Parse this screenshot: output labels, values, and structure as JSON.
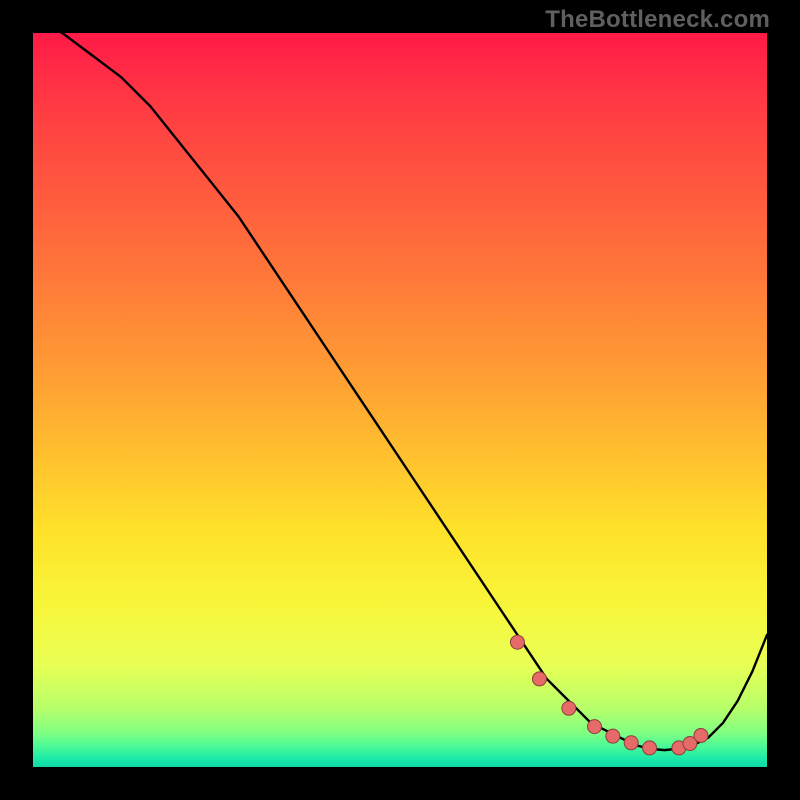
{
  "watermark": "TheBottleneck.com",
  "colors": {
    "bg_black": "#000000",
    "curve": "#000000",
    "dot_fill": "#e66a67",
    "dot_stroke": "#8c3f3d"
  },
  "gradient_stops": [
    {
      "offset": 0.0,
      "color": "#ff1a47"
    },
    {
      "offset": 0.1,
      "color": "#ff3b43"
    },
    {
      "offset": 0.22,
      "color": "#ff5a3e"
    },
    {
      "offset": 0.35,
      "color": "#ff7d39"
    },
    {
      "offset": 0.48,
      "color": "#ffa233"
    },
    {
      "offset": 0.58,
      "color": "#ffc22e"
    },
    {
      "offset": 0.68,
      "color": "#ffe22a"
    },
    {
      "offset": 0.78,
      "color": "#f8f63a"
    },
    {
      "offset": 0.86,
      "color": "#e9ff55"
    },
    {
      "offset": 0.92,
      "color": "#b7ff6a"
    },
    {
      "offset": 0.955,
      "color": "#7dff83"
    },
    {
      "offset": 0.975,
      "color": "#41f79a"
    },
    {
      "offset": 0.99,
      "color": "#18e9a8"
    },
    {
      "offset": 1.0,
      "color": "#0fd8a4"
    }
  ],
  "chart_data": {
    "type": "line",
    "title": "",
    "xlabel": "",
    "ylabel": "",
    "xlim": [
      0,
      100
    ],
    "ylim": [
      0,
      100
    ],
    "series": [
      {
        "name": "bottleneck-curve",
        "x": [
          0,
          4,
          8,
          12,
          16,
          20,
          24,
          28,
          32,
          36,
          40,
          44,
          48,
          52,
          56,
          60,
          64,
          68,
          70,
          72,
          74,
          76,
          78,
          80,
          82,
          84,
          86,
          88,
          90,
          92,
          94,
          96,
          98,
          100
        ],
        "y": [
          102,
          100,
          97,
          94,
          90,
          85,
          80,
          75,
          69,
          63,
          57,
          51,
          45,
          39,
          33,
          27,
          21,
          15,
          12,
          10,
          8,
          6,
          5,
          4,
          3,
          2.5,
          2.3,
          2.5,
          3,
          4,
          6,
          9,
          13,
          18
        ]
      }
    ],
    "highlight_points": {
      "name": "optimal-zone-dots",
      "x": [
        66,
        69,
        73,
        76.5,
        79,
        81.5,
        84,
        88,
        89.5,
        91
      ],
      "y": [
        17,
        12,
        8,
        5.5,
        4.2,
        3.3,
        2.6,
        2.6,
        3.2,
        4.3
      ]
    }
  }
}
